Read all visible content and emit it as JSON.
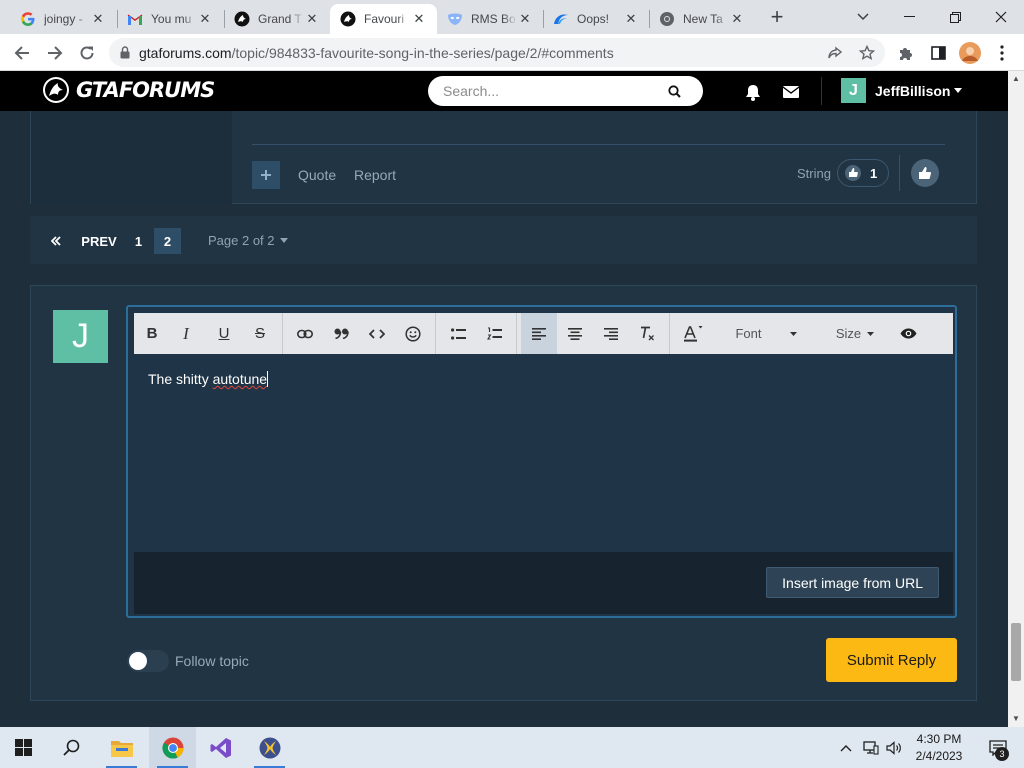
{
  "browser": {
    "tabs": [
      {
        "title": "joingy - ",
        "favicon": "google-g-icon",
        "active": false
      },
      {
        "title": "You mu",
        "favicon": "gmail-icon",
        "active": false
      },
      {
        "title": "Grand T",
        "favicon": "gtaforums-icon",
        "active": false
      },
      {
        "title": "Favouri",
        "favicon": "gtaforums-icon",
        "active": true
      },
      {
        "title": "RMS Bo",
        "favicon": "mask-icon",
        "active": false
      },
      {
        "title": "Oops!",
        "favicon": "wave-icon",
        "active": false
      },
      {
        "title": "New Ta",
        "favicon": "chrome-icon",
        "active": false
      }
    ],
    "url_host": "gtaforums.com",
    "url_path": "/topic/984833-favourite-song-in-the-series/page/2/#comments"
  },
  "site": {
    "logo_text": "GTAFORUMS",
    "search_placeholder": "Search...",
    "username": "JeffBillison",
    "avatar_letter": "J"
  },
  "post_footer": {
    "quote": "Quote",
    "report": "Report",
    "reaction_user": "String",
    "reaction_count": "1"
  },
  "pagination": {
    "prev": "PREV",
    "pages": [
      "1",
      "2"
    ],
    "current_page": "2",
    "info": "Page 2 of 2"
  },
  "reply": {
    "avatar_letter": "J",
    "toolbar": {
      "bold": "B",
      "italic": "I",
      "underline": "U",
      "strike": "S",
      "font": "Font",
      "size": "Size"
    },
    "text_before": "The shitty ",
    "text_misspelled": "autotune",
    "insert_image": "Insert image from URL",
    "follow_topic": "Follow topic",
    "follow_enabled": false,
    "submit": "Submit Reply"
  },
  "taskbar": {
    "time": "4:30 PM",
    "date": "2/4/2023",
    "notifications": "3"
  },
  "colors": {
    "accent": "#fdb913",
    "avatar": "#5fbfa4",
    "editor_border": "#2c6e99",
    "page_bg": "#1f2e3b"
  }
}
